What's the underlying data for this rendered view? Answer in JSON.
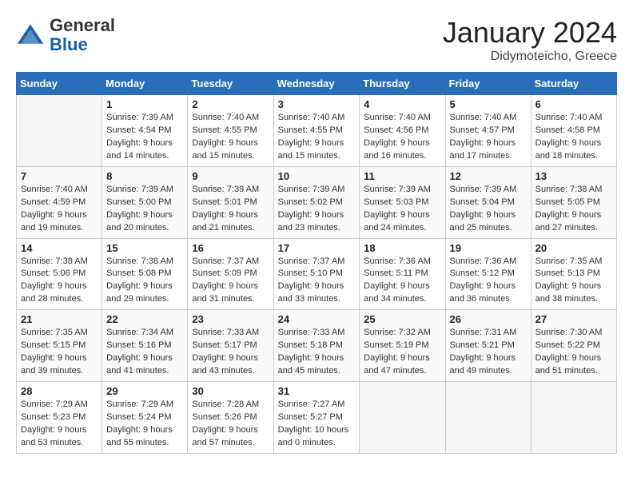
{
  "header": {
    "logo_general": "General",
    "logo_blue": "Blue",
    "month_title": "January 2024",
    "location": "Didymoteicho, Greece"
  },
  "weekdays": [
    "Sunday",
    "Monday",
    "Tuesday",
    "Wednesday",
    "Thursday",
    "Friday",
    "Saturday"
  ],
  "weeks": [
    [
      {
        "day": "",
        "info": ""
      },
      {
        "day": "1",
        "info": "Sunrise: 7:39 AM\nSunset: 4:54 PM\nDaylight: 9 hours\nand 14 minutes."
      },
      {
        "day": "2",
        "info": "Sunrise: 7:40 AM\nSunset: 4:55 PM\nDaylight: 9 hours\nand 15 minutes."
      },
      {
        "day": "3",
        "info": "Sunrise: 7:40 AM\nSunset: 4:55 PM\nDaylight: 9 hours\nand 15 minutes."
      },
      {
        "day": "4",
        "info": "Sunrise: 7:40 AM\nSunset: 4:56 PM\nDaylight: 9 hours\nand 16 minutes."
      },
      {
        "day": "5",
        "info": "Sunrise: 7:40 AM\nSunset: 4:57 PM\nDaylight: 9 hours\nand 17 minutes."
      },
      {
        "day": "6",
        "info": "Sunrise: 7:40 AM\nSunset: 4:58 PM\nDaylight: 9 hours\nand 18 minutes."
      }
    ],
    [
      {
        "day": "7",
        "info": "Sunrise: 7:40 AM\nSunset: 4:59 PM\nDaylight: 9 hours\nand 19 minutes."
      },
      {
        "day": "8",
        "info": "Sunrise: 7:39 AM\nSunset: 5:00 PM\nDaylight: 9 hours\nand 20 minutes."
      },
      {
        "day": "9",
        "info": "Sunrise: 7:39 AM\nSunset: 5:01 PM\nDaylight: 9 hours\nand 21 minutes."
      },
      {
        "day": "10",
        "info": "Sunrise: 7:39 AM\nSunset: 5:02 PM\nDaylight: 9 hours\nand 23 minutes."
      },
      {
        "day": "11",
        "info": "Sunrise: 7:39 AM\nSunset: 5:03 PM\nDaylight: 9 hours\nand 24 minutes."
      },
      {
        "day": "12",
        "info": "Sunrise: 7:39 AM\nSunset: 5:04 PM\nDaylight: 9 hours\nand 25 minutes."
      },
      {
        "day": "13",
        "info": "Sunrise: 7:38 AM\nSunset: 5:05 PM\nDaylight: 9 hours\nand 27 minutes."
      }
    ],
    [
      {
        "day": "14",
        "info": "Sunrise: 7:38 AM\nSunset: 5:06 PM\nDaylight: 9 hours\nand 28 minutes."
      },
      {
        "day": "15",
        "info": "Sunrise: 7:38 AM\nSunset: 5:08 PM\nDaylight: 9 hours\nand 29 minutes."
      },
      {
        "day": "16",
        "info": "Sunrise: 7:37 AM\nSunset: 5:09 PM\nDaylight: 9 hours\nand 31 minutes."
      },
      {
        "day": "17",
        "info": "Sunrise: 7:37 AM\nSunset: 5:10 PM\nDaylight: 9 hours\nand 33 minutes."
      },
      {
        "day": "18",
        "info": "Sunrise: 7:36 AM\nSunset: 5:11 PM\nDaylight: 9 hours\nand 34 minutes."
      },
      {
        "day": "19",
        "info": "Sunrise: 7:36 AM\nSunset: 5:12 PM\nDaylight: 9 hours\nand 36 minutes."
      },
      {
        "day": "20",
        "info": "Sunrise: 7:35 AM\nSunset: 5:13 PM\nDaylight: 9 hours\nand 38 minutes."
      }
    ],
    [
      {
        "day": "21",
        "info": "Sunrise: 7:35 AM\nSunset: 5:15 PM\nDaylight: 9 hours\nand 39 minutes."
      },
      {
        "day": "22",
        "info": "Sunrise: 7:34 AM\nSunset: 5:16 PM\nDaylight: 9 hours\nand 41 minutes."
      },
      {
        "day": "23",
        "info": "Sunrise: 7:33 AM\nSunset: 5:17 PM\nDaylight: 9 hours\nand 43 minutes."
      },
      {
        "day": "24",
        "info": "Sunrise: 7:33 AM\nSunset: 5:18 PM\nDaylight: 9 hours\nand 45 minutes."
      },
      {
        "day": "25",
        "info": "Sunrise: 7:32 AM\nSunset: 5:19 PM\nDaylight: 9 hours\nand 47 minutes."
      },
      {
        "day": "26",
        "info": "Sunrise: 7:31 AM\nSunset: 5:21 PM\nDaylight: 9 hours\nand 49 minutes."
      },
      {
        "day": "27",
        "info": "Sunrise: 7:30 AM\nSunset: 5:22 PM\nDaylight: 9 hours\nand 51 minutes."
      }
    ],
    [
      {
        "day": "28",
        "info": "Sunrise: 7:29 AM\nSunset: 5:23 PM\nDaylight: 9 hours\nand 53 minutes."
      },
      {
        "day": "29",
        "info": "Sunrise: 7:29 AM\nSunset: 5:24 PM\nDaylight: 9 hours\nand 55 minutes."
      },
      {
        "day": "30",
        "info": "Sunrise: 7:28 AM\nSunset: 5:26 PM\nDaylight: 9 hours\nand 57 minutes."
      },
      {
        "day": "31",
        "info": "Sunrise: 7:27 AM\nSunset: 5:27 PM\nDaylight: 10 hours\nand 0 minutes."
      },
      {
        "day": "",
        "info": ""
      },
      {
        "day": "",
        "info": ""
      },
      {
        "day": "",
        "info": ""
      }
    ]
  ]
}
